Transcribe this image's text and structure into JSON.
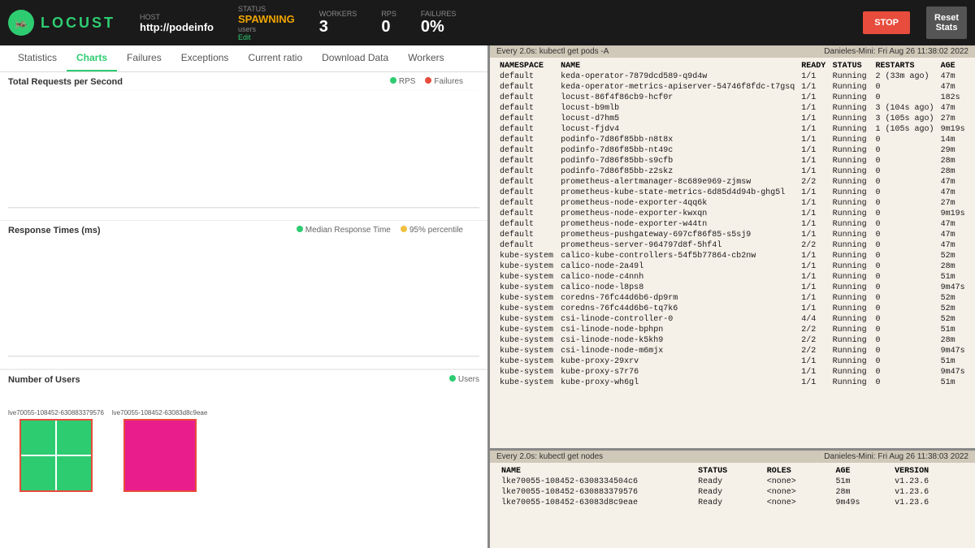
{
  "topbar": {
    "logo": "LOCUST",
    "host_label": "HOST",
    "host_value": "http://podeinfo",
    "status_label": "STATUS",
    "status_value": "SPAWNING",
    "status_sub": "users",
    "status_edit": "Edit",
    "workers_label": "WORKERS",
    "workers_value": "3",
    "rps_label": "RPS",
    "rps_value": "0",
    "failures_label": "FAILURES",
    "failures_value": "0%",
    "stop_label": "STOP",
    "reset_label": "Reset\nStats"
  },
  "nav": {
    "tabs": [
      "Statistics",
      "Charts",
      "Failures",
      "Exceptions",
      "Current ratio",
      "Download Data",
      "Workers"
    ]
  },
  "charts": {
    "rps_title": "Total Requests per Second",
    "rps_legend_rps": "RPS",
    "rps_legend_failures": "Failures",
    "response_title": "Response Times (ms)",
    "response_legend_median": "Median Response Time",
    "response_legend_95": "95% percentile",
    "users_title": "Number of Users",
    "users_legend_users": "Users"
  },
  "workers": [
    {
      "label": "lke70055-108452-630883379576",
      "cells": [
        "green",
        "green",
        "green",
        "green"
      ]
    },
    {
      "label": "lke70055-108452-63083d8c9eae",
      "cells": [
        "magenta",
        "magenta",
        "magenta",
        "magenta"
      ]
    }
  ],
  "terminal_top": {
    "header_left": "Every 2.0s: kubectl get pods -A",
    "header_right": "Danieles-Mini: Fri Aug 26 11:38:02 2022",
    "columns": [
      "NAMESPACE",
      "NAME",
      "READY",
      "STATUS",
      "RESTARTS",
      "AGE"
    ],
    "rows": [
      [
        "default",
        "keda-operator-7879dcd589-q9d4w",
        "1/1",
        "Running",
        "2 (33m ago)",
        "47m"
      ],
      [
        "default",
        "keda-operator-metrics-apiserver-54746f8fdc-t7gsq",
        "1/1",
        "Running",
        "0",
        "47m"
      ],
      [
        "default",
        "locust-86f4f86cb9-hcf0r",
        "1/1",
        "Running",
        "0",
        "182s"
      ],
      [
        "default",
        "locust-b9mlb",
        "1/1",
        "Running",
        "3 (104s ago)",
        "47m"
      ],
      [
        "default",
        "locust-d7hm5",
        "1/1",
        "Running",
        "3 (105s ago)",
        "27m"
      ],
      [
        "default",
        "locust-fjdv4",
        "1/1",
        "Running",
        "1 (105s ago)",
        "9m19s"
      ],
      [
        "default",
        "podinfo-7d86f85bb-n8t8x",
        "1/1",
        "Running",
        "0",
        "14m"
      ],
      [
        "default",
        "podinfo-7d86f85bb-nt49c",
        "1/1",
        "Running",
        "0",
        "29m"
      ],
      [
        "default",
        "podinfo-7d86f85bb-s9cfb",
        "1/1",
        "Running",
        "0",
        "28m"
      ],
      [
        "default",
        "podinfo-7d86f85bb-z2skz",
        "1/1",
        "Running",
        "0",
        "28m"
      ],
      [
        "default",
        "prometheus-alertmanager-8c689e969-zjmsw",
        "2/2",
        "Running",
        "0",
        "47m"
      ],
      [
        "default",
        "prometheus-kube-state-metrics-6d85d4d94b-ghg5l",
        "1/1",
        "Running",
        "0",
        "47m"
      ],
      [
        "default",
        "prometheus-node-exporter-4qq6k",
        "1/1",
        "Running",
        "0",
        "27m"
      ],
      [
        "default",
        "prometheus-node-exporter-kwxqn",
        "1/1",
        "Running",
        "0",
        "9m19s"
      ],
      [
        "default",
        "prometheus-node-exporter-w44tn",
        "1/1",
        "Running",
        "0",
        "47m"
      ],
      [
        "default",
        "prometheus-pushgateway-697cf86f85-s5sj9",
        "1/1",
        "Running",
        "0",
        "47m"
      ],
      [
        "default",
        "prometheus-server-964797d8f-5hf4l",
        "2/2",
        "Running",
        "0",
        "47m"
      ],
      [
        "kube-system",
        "calico-kube-controllers-54f5b77864-cb2nw",
        "1/1",
        "Running",
        "0",
        "52m"
      ],
      [
        "kube-system",
        "calico-node-2a49l",
        "1/1",
        "Running",
        "0",
        "28m"
      ],
      [
        "kube-system",
        "calico-node-c4nnh",
        "1/1",
        "Running",
        "0",
        "51m"
      ],
      [
        "kube-system",
        "calico-node-l8ps8",
        "1/1",
        "Running",
        "0",
        "9m47s"
      ],
      [
        "kube-system",
        "coredns-76fc44d6b6-dp9rm",
        "1/1",
        "Running",
        "0",
        "52m"
      ],
      [
        "kube-system",
        "coredns-76fc44d6b6-tq7k6",
        "1/1",
        "Running",
        "0",
        "52m"
      ],
      [
        "kube-system",
        "csi-linode-controller-0",
        "4/4",
        "Running",
        "0",
        "52m"
      ],
      [
        "kube-system",
        "csi-linode-node-bphpn",
        "2/2",
        "Running",
        "0",
        "51m"
      ],
      [
        "kube-system",
        "csi-linode-node-k5kh9",
        "2/2",
        "Running",
        "0",
        "28m"
      ],
      [
        "kube-system",
        "csi-linode-node-m6mjx",
        "2/2",
        "Running",
        "0",
        "9m47s"
      ],
      [
        "kube-system",
        "kube-proxy-29xrv",
        "1/1",
        "Running",
        "0",
        "51m"
      ],
      [
        "kube-system",
        "kube-proxy-s7r76",
        "1/1",
        "Running",
        "0",
        "9m47s"
      ],
      [
        "kube-system",
        "kube-proxy-wh6gl",
        "1/1",
        "Running",
        "0",
        "51m"
      ]
    ]
  },
  "terminal_bottom": {
    "header_left": "Every 2.0s: kubectl get nodes",
    "header_right": "Danieles-Mini: Fri Aug 26 11:38:03 2022",
    "columns": [
      "NAME",
      "STATUS",
      "ROLES",
      "AGE",
      "VERSION"
    ],
    "rows": [
      [
        "lke70055-108452-6308334504c6",
        "Ready",
        "<none>",
        "51m",
        "v1.23.6"
      ],
      [
        "lke70055-108452-630883379576",
        "Ready",
        "<none>",
        "28m",
        "v1.23.6"
      ],
      [
        "lke70055-108452-63083d8c9eae",
        "Ready",
        "<none>",
        "9m49s",
        "v1.23.6"
      ]
    ]
  },
  "colors": {
    "green": "#2ecc71",
    "magenta": "#e91e8c",
    "red": "#e74c3c",
    "accent": "#2ecc71"
  }
}
